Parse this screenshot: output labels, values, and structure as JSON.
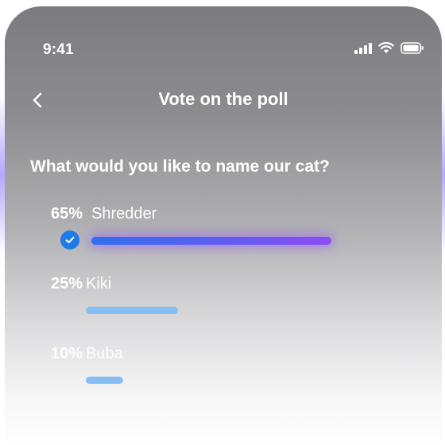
{
  "status_bar": {
    "time": "9:41",
    "icons": [
      "cellular-signal-icon",
      "wifi-icon",
      "battery-icon"
    ]
  },
  "header": {
    "back_icon": "chevron-left-icon",
    "title": "Vote on the poll"
  },
  "poll": {
    "question": "What would you like to name our cat?",
    "options": [
      {
        "percent_label": "65%",
        "percent": 65,
        "label": "Shredder",
        "selected": true,
        "bar_color": "#8c4cf4"
      },
      {
        "percent_label": "25%",
        "percent": 25,
        "label": "Kiki",
        "selected": false,
        "bar_color": "#86bdf3"
      },
      {
        "percent_label": "10%",
        "percent": 10,
        "label": "Buba",
        "selected": false,
        "bar_color": "#86bdf3"
      }
    ],
    "selected_icon": "checkmark-icon"
  },
  "colors": {
    "accent_blue": "#1f7be8",
    "accent_purple": "#8c4cf4",
    "bar_unselected": "#86bdf3"
  }
}
